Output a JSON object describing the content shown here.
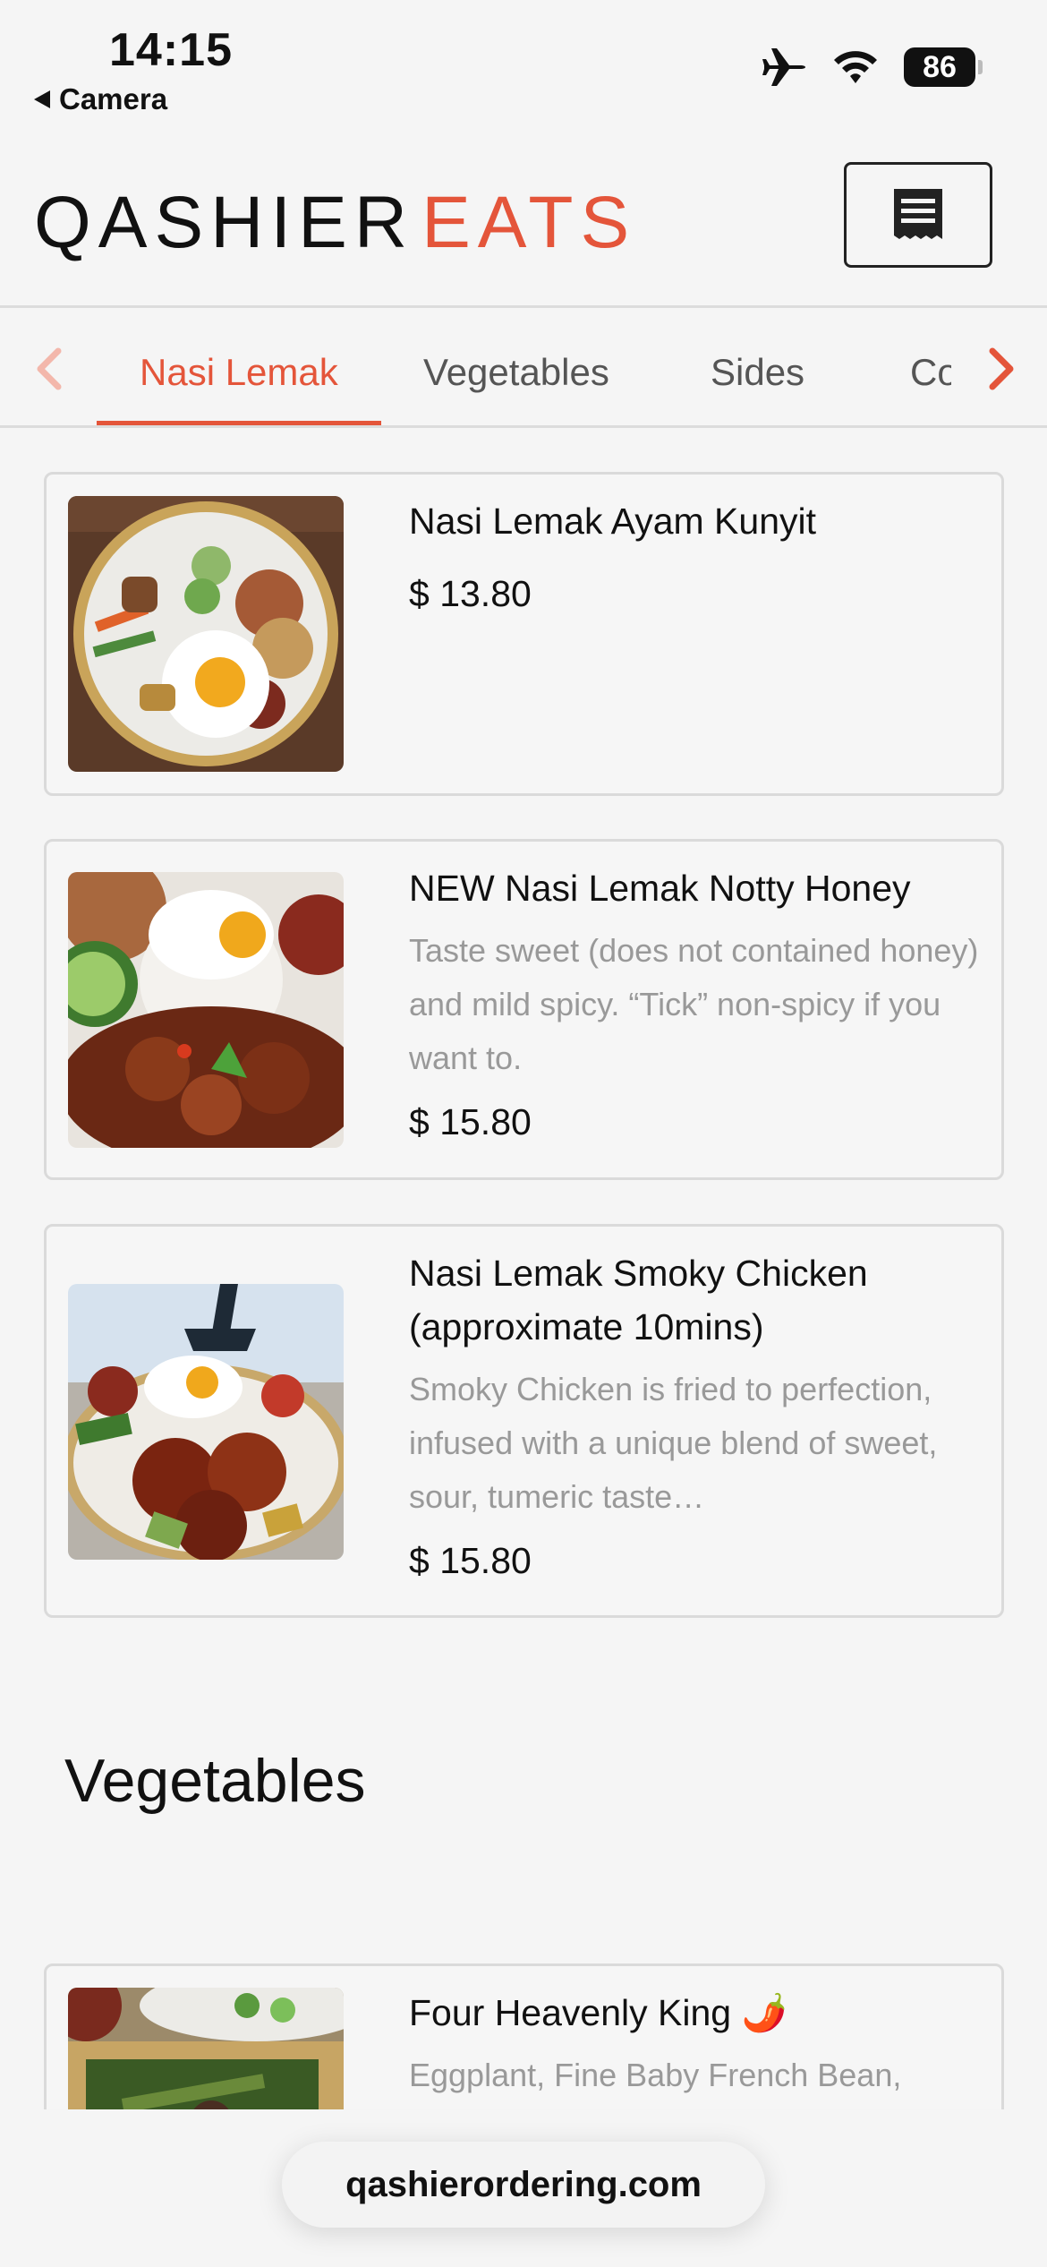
{
  "status_bar": {
    "time": "14:15",
    "back_app": "Camera",
    "battery": "86"
  },
  "header": {
    "logo_part1": "QASHIER",
    "logo_part2": "EATS"
  },
  "tabs": [
    {
      "label": "Nasi Lemak",
      "active": true
    },
    {
      "label": "Vegetables",
      "active": false
    },
    {
      "label": "Sides",
      "active": false
    },
    {
      "label": "Co",
      "active": false
    }
  ],
  "items": [
    {
      "title": "Nasi Lemak Ayam Kunyit",
      "description": "",
      "price": "$ 13.80"
    },
    {
      "title": "NEW Nasi Lemak Notty Honey",
      "description": "Taste sweet (does not contained honey) and mild spicy. “Tick” non-spicy if you want to.",
      "price": "$ 15.80"
    },
    {
      "title": "Nasi Lemak Smoky Chicken (approximate 10mins)",
      "description": "Smoky Chicken is fried to perfection, infused with a unique blend of sweet, sour, tumeric taste…",
      "price": "$ 15.80"
    }
  ],
  "section": {
    "title": "Vegetables",
    "items": [
      {
        "title": "Four Heavenly King 🌶️",
        "description": "Eggplant, Fine Baby French Bean,"
      }
    ]
  },
  "url_bar": {
    "domain": "qashierordering.com"
  },
  "colors": {
    "accent": "#e4553a",
    "background": "#f5f5f5",
    "muted_text": "#999999"
  },
  "icons": [
    "back-triangle-icon",
    "airplane-icon",
    "wifi-icon",
    "battery-icon",
    "receipt-menu-icon",
    "chevron-left-icon",
    "chevron-right-icon"
  ]
}
